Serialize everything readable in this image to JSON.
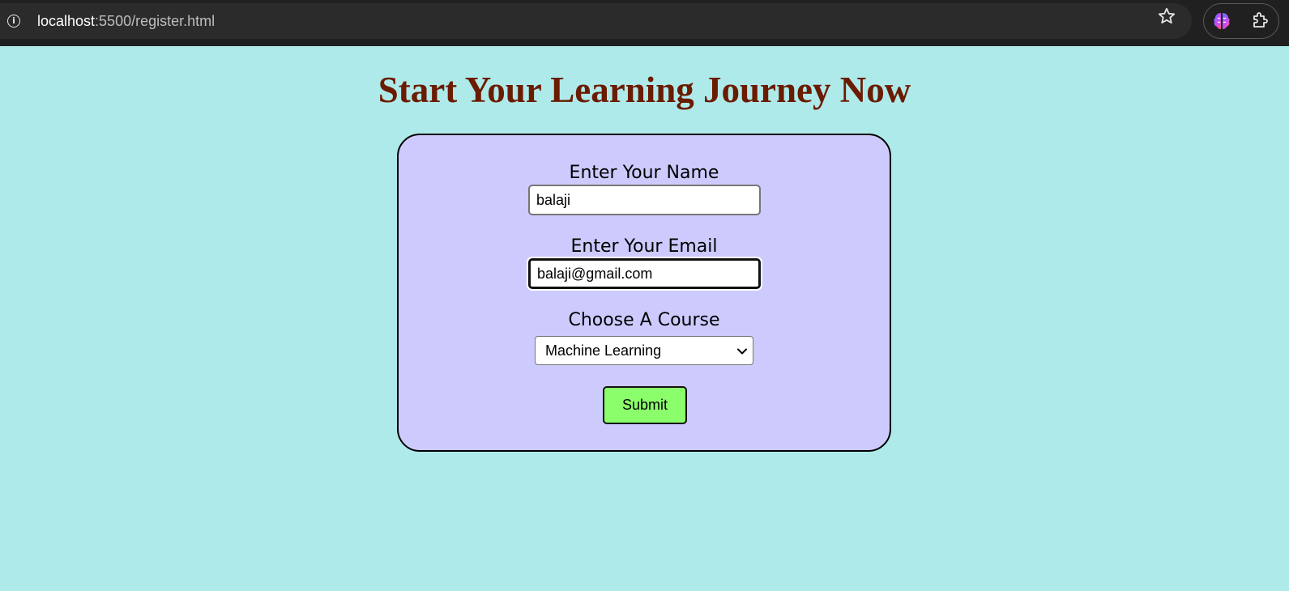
{
  "browser": {
    "url_host": "localhost",
    "url_path": ":5500/register.html",
    "icons": [
      "info-icon",
      "star-icon",
      "brain-extension-icon",
      "puzzle-extensions-icon"
    ]
  },
  "page": {
    "title": "Start Your Learning Journey Now",
    "title_color": "#6b1b00",
    "background_color": "#afeaea"
  },
  "form": {
    "background_color": "#cdcbfd",
    "name_label": "Enter Your Name",
    "name_value": "balaji",
    "email_label": "Enter Your Email",
    "email_value": "balaji@gmail.com",
    "course_label": "Choose A Course",
    "course_selected": "Machine Learning",
    "submit_label": "Submit",
    "submit_color": "#8bff6b"
  }
}
